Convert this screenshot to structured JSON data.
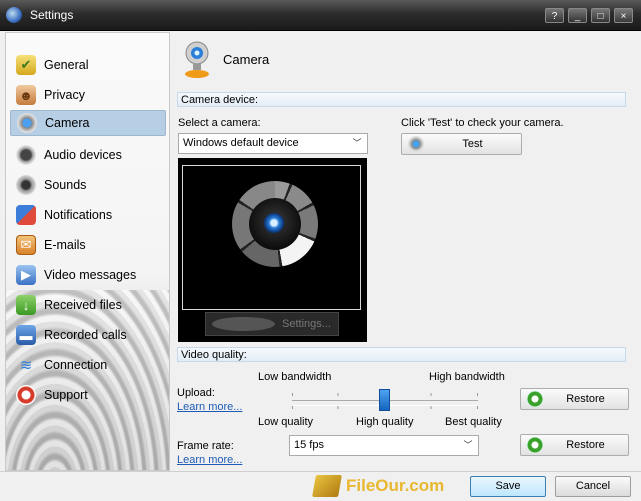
{
  "window": {
    "title": "Settings",
    "controls": [
      "?",
      "_",
      "□",
      "×"
    ]
  },
  "sidebar": {
    "items": [
      {
        "label": "General",
        "icon": "general-icon"
      },
      {
        "label": "Privacy",
        "icon": "privacy-icon"
      },
      {
        "label": "Camera",
        "icon": "camera-icon",
        "active": true
      },
      {
        "label": "Audio devices",
        "icon": "audio-devices-icon"
      },
      {
        "label": "Sounds",
        "icon": "sounds-icon"
      },
      {
        "label": "Notifications",
        "icon": "notifications-icon"
      },
      {
        "label": "E-mails",
        "icon": "emails-icon"
      },
      {
        "label": "Video messages",
        "icon": "video-messages-icon"
      },
      {
        "label": "Received files",
        "icon": "received-files-icon"
      },
      {
        "label": "Recorded calls",
        "icon": "recorded-calls-icon"
      },
      {
        "label": "Connection",
        "icon": "connection-icon"
      },
      {
        "label": "Support",
        "icon": "support-icon"
      }
    ]
  },
  "main": {
    "title": "Camera",
    "camera_device_section": "Camera device:",
    "select_camera_label": "Select a camera:",
    "camera_select_value": "Windows default device",
    "test_hint": "Click 'Test' to check your camera.",
    "test_button": "Test",
    "settings_button": "Settings...",
    "video_quality_section": "Video quality:",
    "upload_label": "Upload:",
    "learn_more": "Learn more...",
    "low_bandwidth": "Low bandwidth",
    "high_bandwidth": "High bandwidth",
    "low_quality": "Low quality",
    "high_quality": "High quality",
    "best_quality": "Best quality",
    "restore_button": "Restore",
    "frame_rate_label": "Frame rate:",
    "frame_rate_value": "15 fps",
    "slider_level": 0.5
  },
  "footer": {
    "watermark": "FileOur.com",
    "save_button": "Save",
    "cancel_button": "Cancel"
  },
  "colors": {
    "accent": "#1565c0",
    "active_nav": "#b7cfe4",
    "link": "#1f5bb4",
    "titlebar": "#2c2c2c"
  }
}
